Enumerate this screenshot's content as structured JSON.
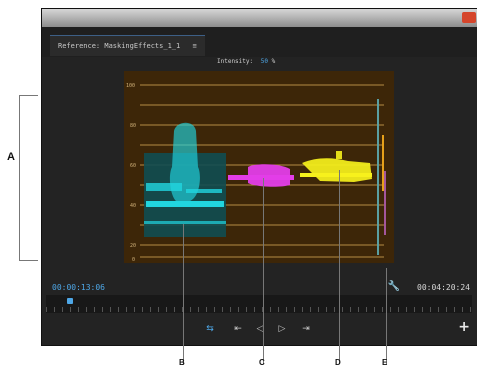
{
  "window": {
    "tab_title": "Reference: MaskingEffects_1_1",
    "tab_menu_icon": "menu-icon"
  },
  "scope": {
    "intensity_label": "Intensity:",
    "intensity_value": "50",
    "intensity_unit": "%",
    "y_ticks": [
      "100",
      "80",
      "60",
      "40",
      "20",
      "0"
    ]
  },
  "transport": {
    "timecode_current": "00:00:13:06",
    "timecode_duration": "00:04:20:24",
    "playhead_position": 0.05
  },
  "callouts": {
    "a": "A",
    "b": "B",
    "c": "C",
    "d": "D",
    "e": "E"
  },
  "colors": {
    "accent_blue": "#4ea7e7",
    "scope_bg": "#3d2608",
    "trace_cyan": "#21d6e0",
    "trace_magenta": "#e33de8",
    "trace_yellow": "#f6f11c"
  }
}
